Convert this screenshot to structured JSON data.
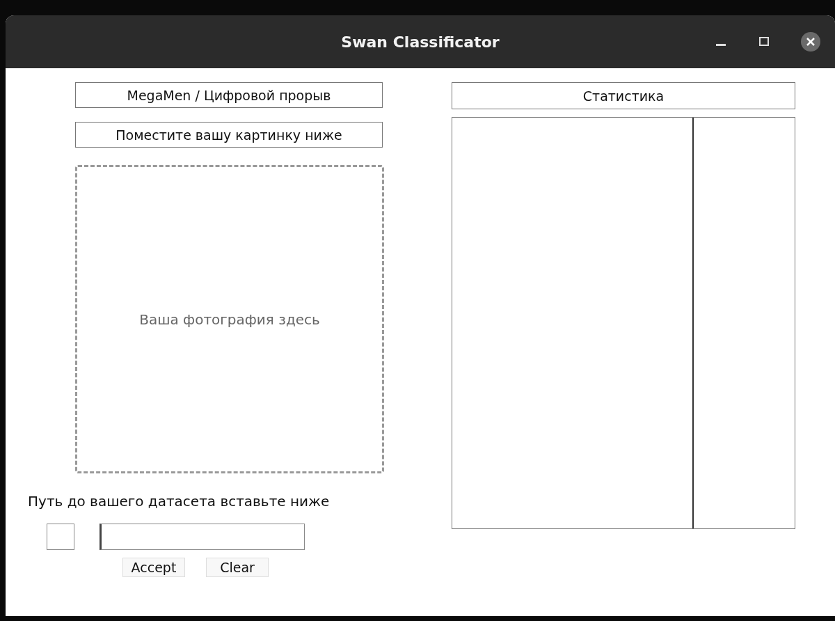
{
  "window": {
    "title": "Swan Classificator"
  },
  "left_panel": {
    "team_label": "MegaMen / Цифровой прорыв",
    "instruction_label": "Поместите вашу картинку ниже",
    "drop_zone": {
      "text": "Ваша фотография здесь"
    },
    "dataset_label": "Путь до вашего датасета вставьте ниже",
    "checkbox": {
      "checked": false
    },
    "buttons": [
      "Accept",
      "Clear"
    ]
  },
  "right_panel": {
    "title": "Статистика"
  }
}
